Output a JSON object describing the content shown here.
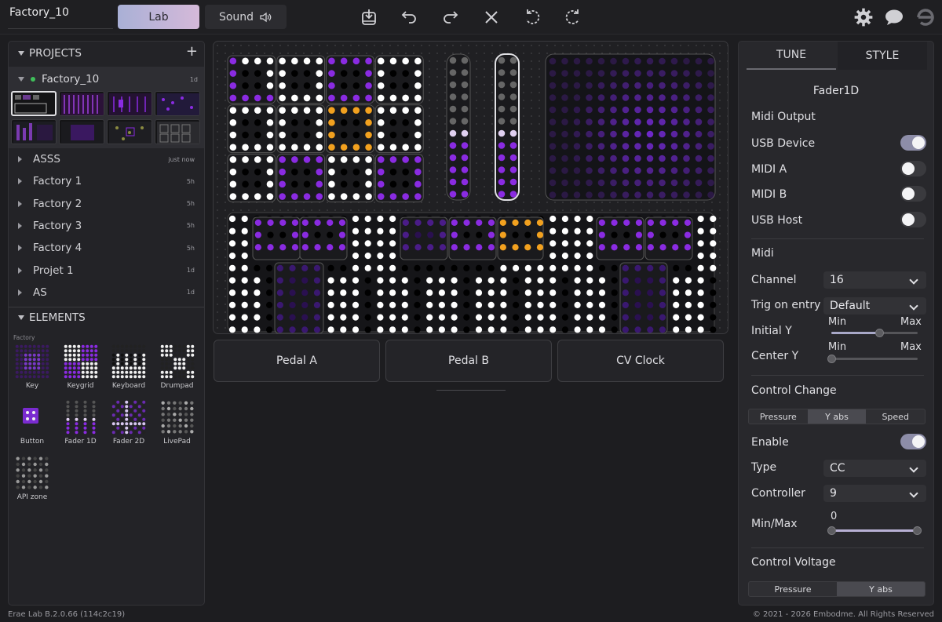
{
  "app": {
    "project_title": "Factory_10",
    "tabs": [
      {
        "label": "Lab",
        "active": true
      },
      {
        "label": "Sound",
        "active": false
      }
    ],
    "accent": "#8a2be2",
    "orange": "#f2a11f"
  },
  "toolbar": {
    "icons": [
      "save-icon",
      "undo-icon",
      "redo-icon",
      "close-icon",
      "rotate-left-icon",
      "rotate-right-icon"
    ],
    "right_icons": [
      "gear-icon",
      "chat-icon",
      "erae-logo-icon"
    ]
  },
  "projects": {
    "header": "PROJECTS",
    "add_label": "+",
    "current": {
      "name": "Factory_10",
      "age": "1d"
    },
    "items": [
      {
        "name": "ASSS",
        "age": "just now"
      },
      {
        "name": "Factory 1",
        "age": "5h"
      },
      {
        "name": "Factory 2",
        "age": "5h"
      },
      {
        "name": "Factory 3",
        "age": "5h"
      },
      {
        "name": "Factory 4",
        "age": "5h"
      },
      {
        "name": "Projet 1",
        "age": "1d"
      },
      {
        "name": "AS",
        "age": "1d"
      }
    ]
  },
  "elements": {
    "header": "ELEMENTS",
    "group": "Factory",
    "items": [
      "Key",
      "Keygrid",
      "Keyboard",
      "Drumpad",
      "Button",
      "Fader 1D",
      "Fader 2D",
      "LivePad",
      "API zone"
    ]
  },
  "pedals": [
    "Pedal A",
    "Pedal B",
    "CV Clock"
  ],
  "inspector": {
    "tabs": [
      "TUNE",
      "STYLE"
    ],
    "element_name": "Fader1D",
    "midi_output": {
      "title": "Midi Output",
      "rows": [
        {
          "label": "USB Device",
          "on": true
        },
        {
          "label": "MIDI A",
          "on": false
        },
        {
          "label": "MIDI B",
          "on": false
        },
        {
          "label": "USB Host",
          "on": false
        }
      ]
    },
    "midi": {
      "title": "Midi",
      "channel_label": "Channel",
      "channel_value": "16",
      "trig_label": "Trig on entry",
      "trig_value": "Default",
      "initial_y_label": "Initial Y",
      "center_y_label": "Center Y",
      "min_label": "Min",
      "max_label": "Max",
      "initial_y_level": 0.55,
      "center_y_level": 0.0
    },
    "control_change": {
      "title": "Control Change",
      "modes": [
        "Pressure",
        "Y abs",
        "Speed"
      ],
      "active_mode": "Y abs",
      "enable_label": "Enable",
      "enable_on": true,
      "type_label": "Type",
      "type_value": "CC",
      "controller_label": "Controller",
      "controller_value": "9",
      "minmax_label": "Min/Max",
      "min_value": "0",
      "range": [
        0.0,
        1.0
      ]
    },
    "control_voltage": {
      "title": "Control Voltage",
      "modes": [
        "Pressure",
        "Y abs"
      ],
      "active_mode": "Y abs"
    }
  },
  "footer": {
    "version": "Erae Lab B.2.0.66 (114c2c19)",
    "copyright": "© 2021 - 2026 Embodme. All Rights Reserved"
  }
}
